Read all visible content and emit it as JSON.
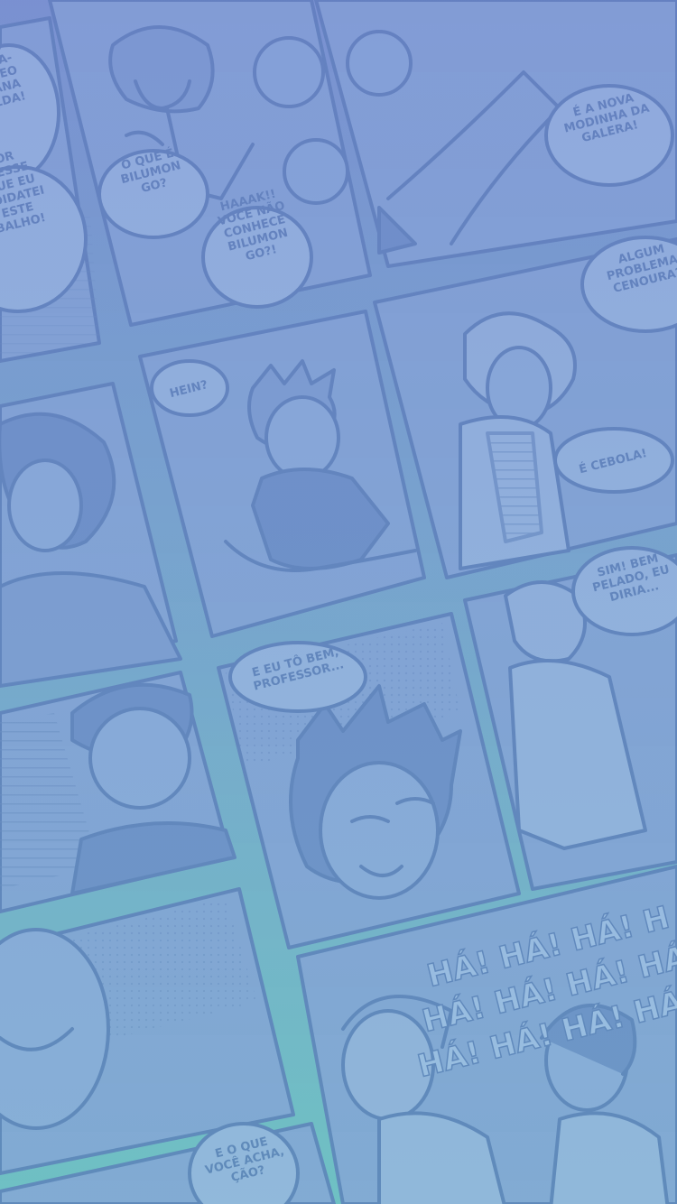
{
  "colors": {
    "top": "#7b93d1",
    "middle": "#7aa2cf",
    "bottom": "#6fc2c3",
    "line": "#5b7ab8",
    "panel": "#86a3d6"
  },
  "comic": {
    "balloons": {
      "b1": [
        "S",
        "GA-",
        "DEO",
        "ANA",
        "LDA!"
      ],
      "b2": [
        "OR",
        "DESSE",
        "QUE EU",
        "ADIDATEI",
        "ESTE",
        "BALHO!"
      ],
      "b3": [
        "O QUE É",
        "BILUMON",
        "GO?"
      ],
      "b4": [
        "HAAAK!!",
        "VOCÊ NÃO",
        "CONHECE",
        "BILUMON",
        "GO?!"
      ],
      "b5": [
        "É A NOVA",
        "MODINHA DA",
        "GALERA!"
      ],
      "b6": [
        "ALGUM",
        "PROBLEMA,",
        "CENOURA?"
      ],
      "b7": [
        "HEIN?"
      ],
      "b8": [
        "É CEBOLA!"
      ],
      "b9": [
        "SIM! BEM",
        "PELADO, EU",
        "DIRIA..."
      ],
      "b10": [
        "E EU TÔ BEM,",
        "PROFESSOR..."
      ],
      "b11": [
        "E O QUE",
        "VOCÊ ACHA,",
        "ÇÃO?"
      ]
    },
    "laugh": [
      "HÁ! HÁ! HÁ! H",
      "HÁ! HÁ! HÁ! HÁ!",
      "HÁ! HÁ! HÁ! HÁ!"
    ]
  }
}
